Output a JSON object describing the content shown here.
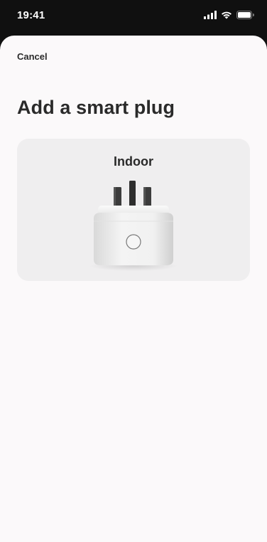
{
  "status_bar": {
    "time": "19:41",
    "icons": [
      "signal-icon",
      "wifi-icon",
      "battery-icon"
    ]
  },
  "nav": {
    "cancel_label": "Cancel"
  },
  "page": {
    "title": "Add a smart plug"
  },
  "options": [
    {
      "label": "Indoor",
      "image": "smart-plug-image"
    }
  ],
  "colors": {
    "status_bar_background": "#101010",
    "sheet_background": "#fbf9fa",
    "card_background": "#efeeef",
    "text_primary": "#2a2a2a"
  }
}
